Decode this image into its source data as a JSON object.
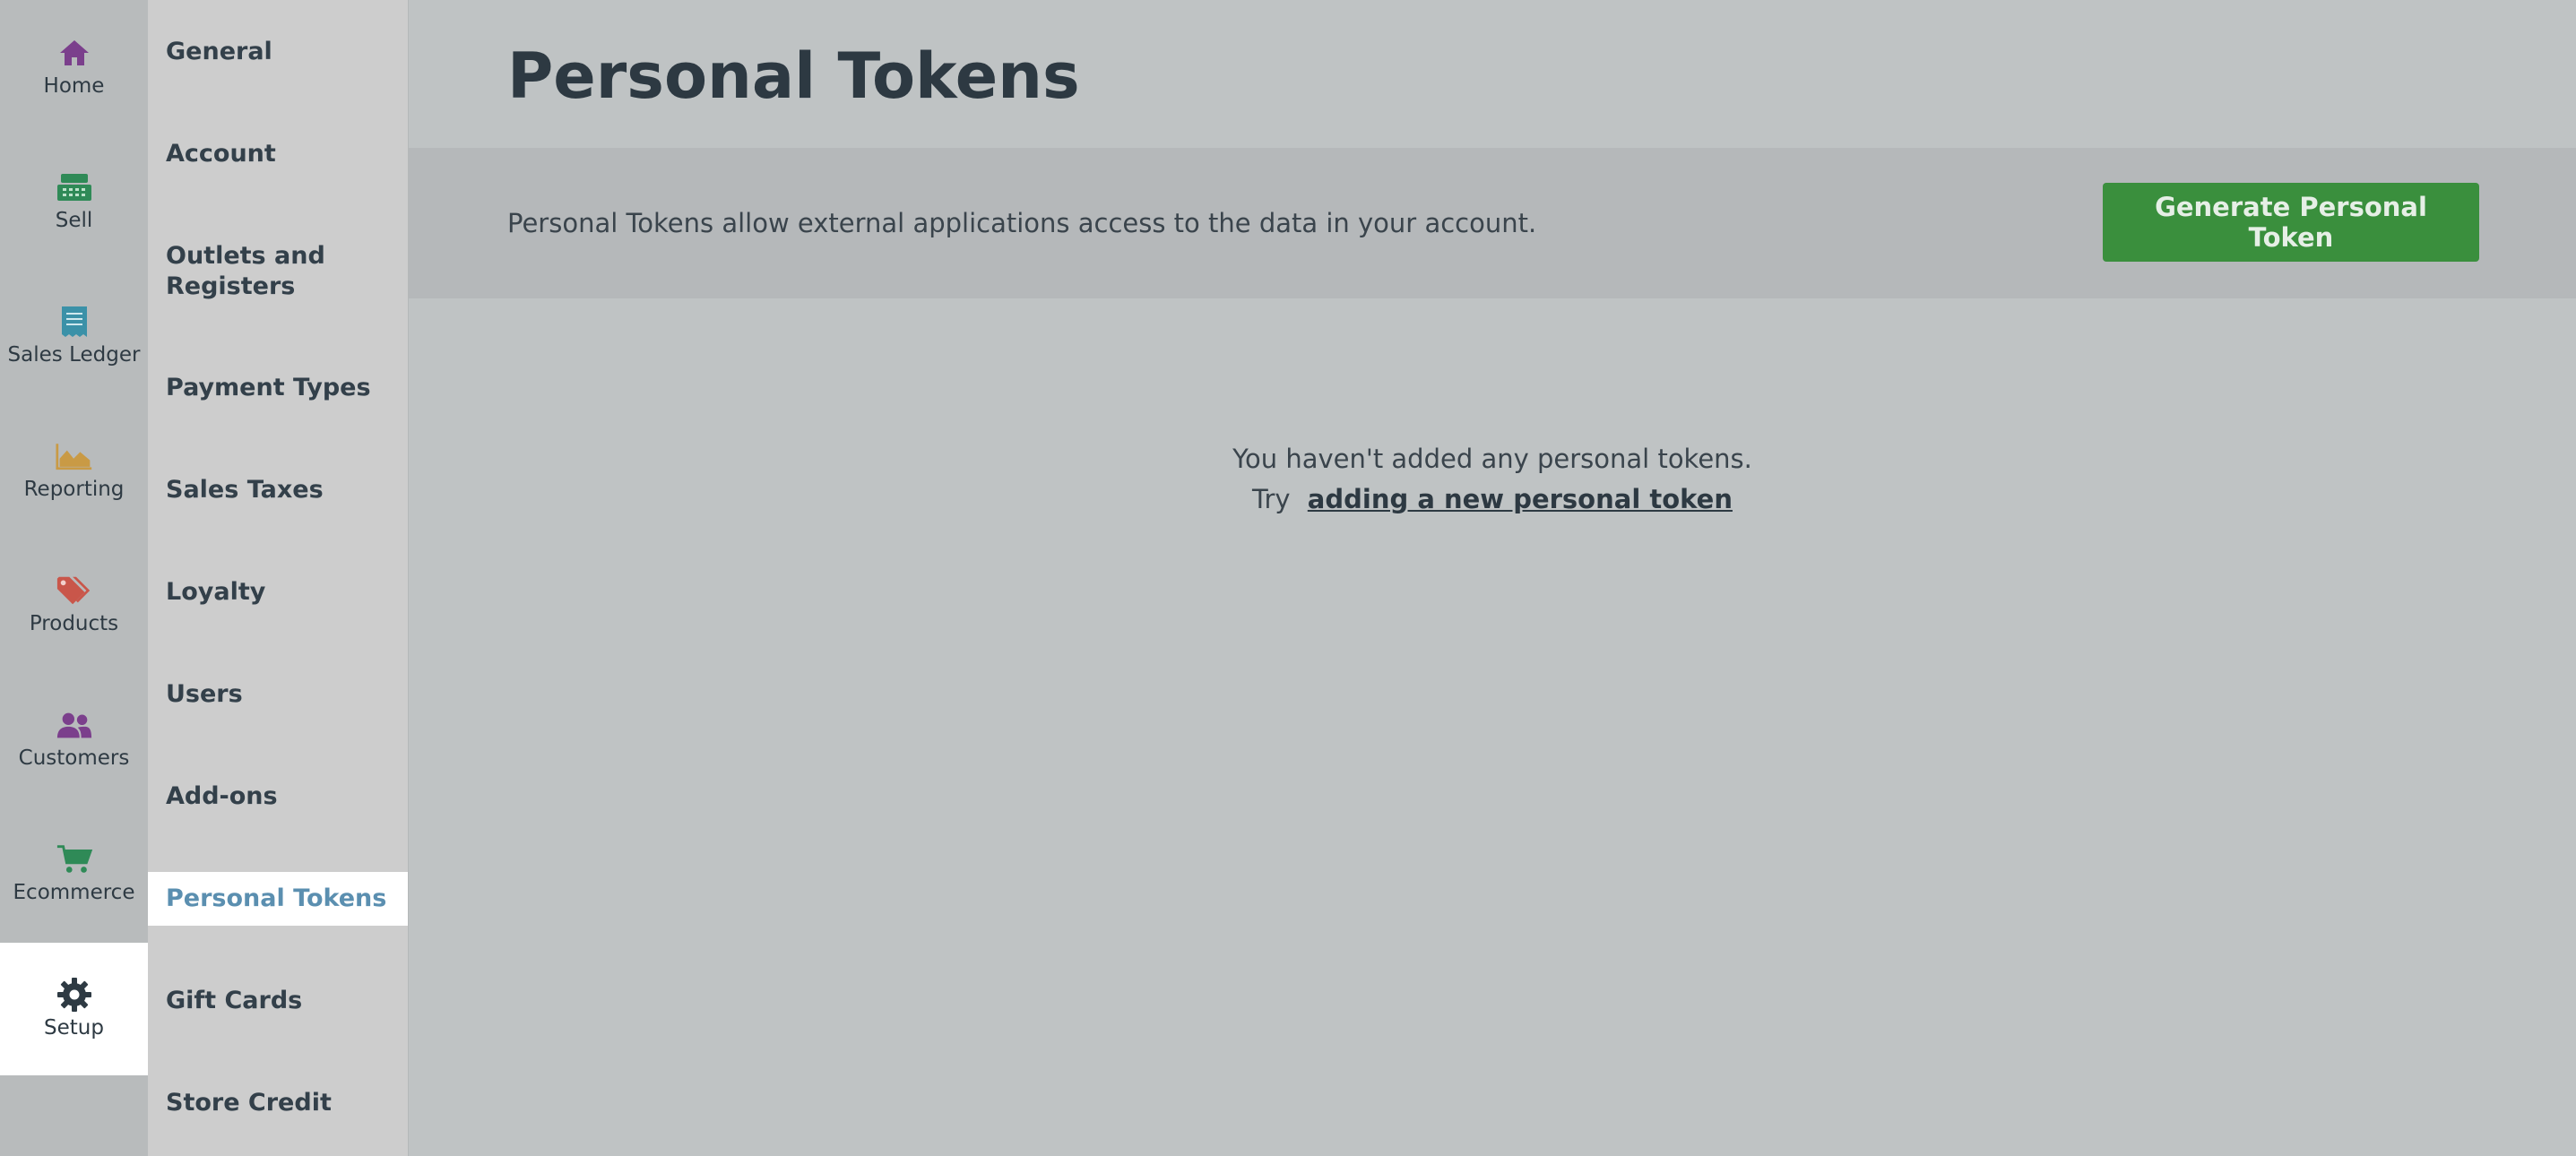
{
  "rail": {
    "items": [
      {
        "label": "Home",
        "icon": "home-icon",
        "color": "#7b3f8c"
      },
      {
        "label": "Sell",
        "icon": "register-icon",
        "color": "#2f8a57"
      },
      {
        "label": "Sales Ledger",
        "icon": "receipt-icon",
        "color": "#3b91a8"
      },
      {
        "label": "Reporting",
        "icon": "chart-icon",
        "color": "#c99a45"
      },
      {
        "label": "Products",
        "icon": "tags-icon",
        "color": "#c9564a"
      },
      {
        "label": "Customers",
        "icon": "users-icon",
        "color": "#7b3f8c"
      },
      {
        "label": "Ecommerce",
        "icon": "cart-icon",
        "color": "#2f8a57"
      },
      {
        "label": "Setup",
        "icon": "gear-icon",
        "color": "#2e3a43"
      }
    ],
    "active": "Setup"
  },
  "submenu": {
    "items": [
      {
        "label": "General"
      },
      {
        "label": "Account"
      },
      {
        "label": "Outlets and Registers"
      },
      {
        "label": "Payment Types"
      },
      {
        "label": "Sales Taxes"
      },
      {
        "label": "Loyalty"
      },
      {
        "label": "Users"
      },
      {
        "label": "Add-ons"
      },
      {
        "label": "Personal Tokens"
      },
      {
        "label": "Gift Cards"
      },
      {
        "label": "Store Credit"
      }
    ],
    "active": "Personal Tokens"
  },
  "main": {
    "title": "Personal Tokens",
    "info_text": "Personal Tokens allow external applications access to the data in your account.",
    "generate_button": "Generate Personal Token",
    "empty_line1": "You haven't added any personal tokens.",
    "empty_try": "Try",
    "empty_link": "adding a new personal token"
  },
  "colors": {
    "accent_green": "#3a8f3d",
    "active_link": "#5b8fb0"
  }
}
